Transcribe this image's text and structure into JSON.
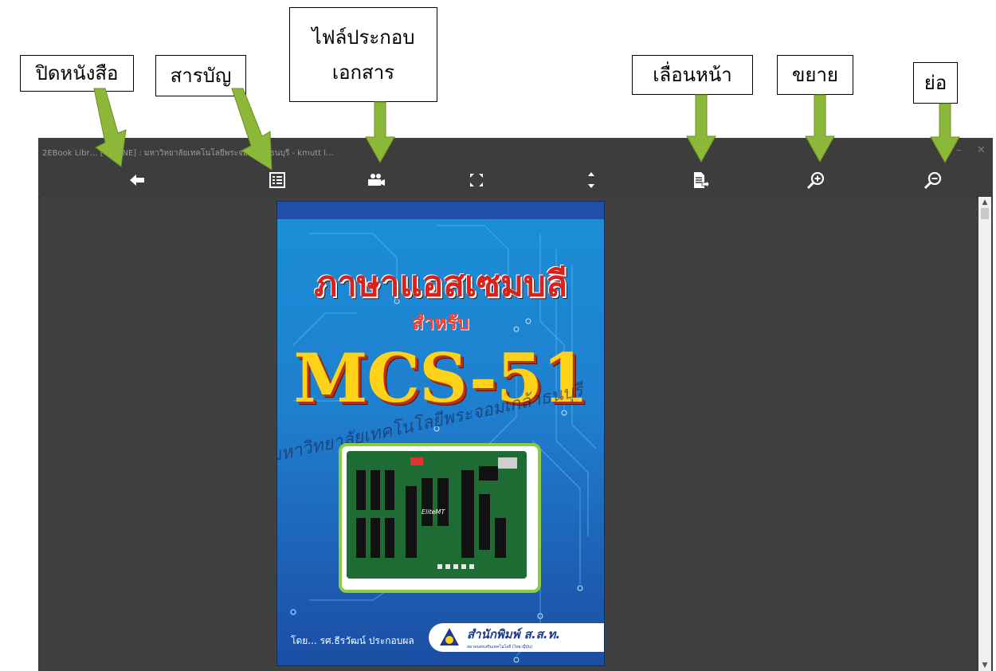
{
  "callouts": {
    "close_book": "ปิดหนังสือ",
    "toc": "สารบัญ",
    "attachment_line1": "ไฟล์ประกอบ",
    "attachment_line2": "เอกสาร",
    "page_turn": "เลื่อนหน้า",
    "zoom_in": "ขยาย",
    "zoom_out": "ย่อ"
  },
  "window": {
    "title": "2EBook Libr… [ONLINE] : มหาวิทยาลัยเทคโนโลยีพระจอมเกล้าธนบุรี  - kmutt l…",
    "minimize": "–",
    "close": "✕"
  },
  "toolbar": {
    "icons": [
      "back-arrow-icon",
      "table-of-contents-icon",
      "video-camera-icon",
      "fullscreen-icon",
      "fit-height-icon",
      "page-turn-icon",
      "zoom-in-icon",
      "zoom-out-icon"
    ]
  },
  "cover": {
    "title_thai": "ภาษาแอสเซมบลี",
    "for": "สำหรับ",
    "main_title": "MCS-51",
    "watermark": "มหาวิทยาลัยเทคโนโลยีพระจอมเกล้าธนบุรี",
    "board_label": "EliteMT",
    "author": "โดย... รศ.ธีรวัฒน์ ประกอบผล",
    "publisher": "สำนักพิมพ์ ส.ส.ท.",
    "publisher_sub": "สมาคมส่งเสริมเทคโนโลยี (ไทย-ญี่ปุ่น)"
  },
  "colors": {
    "window_bg": "#3d3d3d",
    "arrow_green": "#8cb83a",
    "cover_blue": "#1f7fcf",
    "title_red": "#d8231c",
    "mcs_yellow": "#ffd21a"
  }
}
